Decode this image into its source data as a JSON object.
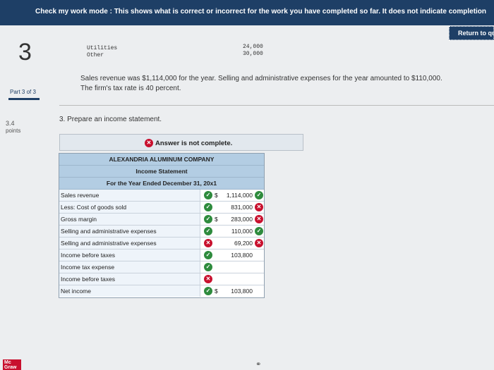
{
  "banner": {
    "text": "Check my work mode : This shows what is correct or incorrect for the work you have completed so far. It does not indicate completion"
  },
  "return_button": "Return to qu",
  "question_number": "3",
  "part": "Part 3 of 3",
  "points": {
    "value": "3.4",
    "label": "points"
  },
  "expenses": [
    {
      "label": "Utilities",
      "value": "24,000"
    },
    {
      "label": "Other",
      "value": "30,000"
    }
  ],
  "problem_text": {
    "line1": "Sales revenue was $1,114,000 for the year. Selling and administrative expenses for the year amounted to $110,000.",
    "line2": "The firm's tax rate is 40 percent."
  },
  "question": "3. Prepare an income statement.",
  "answer_status": "Answer is not complete.",
  "statement": {
    "company": "ALEXANDRIA ALUMINUM COMPANY",
    "title": "Income Statement",
    "period": "For the Year Ended December 31, 20x1",
    "rows": [
      {
        "label": "Sales revenue",
        "mark": "ok",
        "dollar": "$",
        "amount": "1,114,000",
        "amount_mark": "ok"
      },
      {
        "label": "Less: Cost of goods sold",
        "mark": "ok",
        "dollar": "",
        "amount": "831,000",
        "amount_mark": "bad"
      },
      {
        "label": "Gross margin",
        "mark": "ok",
        "dollar": "$",
        "amount": "283,000",
        "amount_mark": "bad"
      },
      {
        "label": "Selling and administrative expenses",
        "mark": "ok",
        "dollar": "",
        "amount": "110,000",
        "amount_mark": "ok"
      },
      {
        "label": "Selling and administrative expenses",
        "mark": "bad",
        "dollar": "",
        "amount": "69,200",
        "amount_mark": "bad"
      },
      {
        "label": "Income before taxes",
        "mark": "ok",
        "dollar": "",
        "amount": "103,800",
        "amount_mark": ""
      },
      {
        "label": "Income tax expense",
        "mark": "ok",
        "dollar": "",
        "amount": "",
        "amount_mark": ""
      },
      {
        "label": "Income before taxes",
        "mark": "bad",
        "dollar": "",
        "amount": "",
        "amount_mark": ""
      },
      {
        "label": "Net income",
        "mark": "ok",
        "dollar": "$",
        "amount": "103,800",
        "amount_mark": ""
      }
    ]
  },
  "logo": {
    "line1": "Mc",
    "line2": "Graw"
  },
  "colors": {
    "navy": "#1e3f66",
    "correct": "#2e8b3d",
    "incorrect": "#c8102e",
    "header_blue": "#b3cde3"
  }
}
